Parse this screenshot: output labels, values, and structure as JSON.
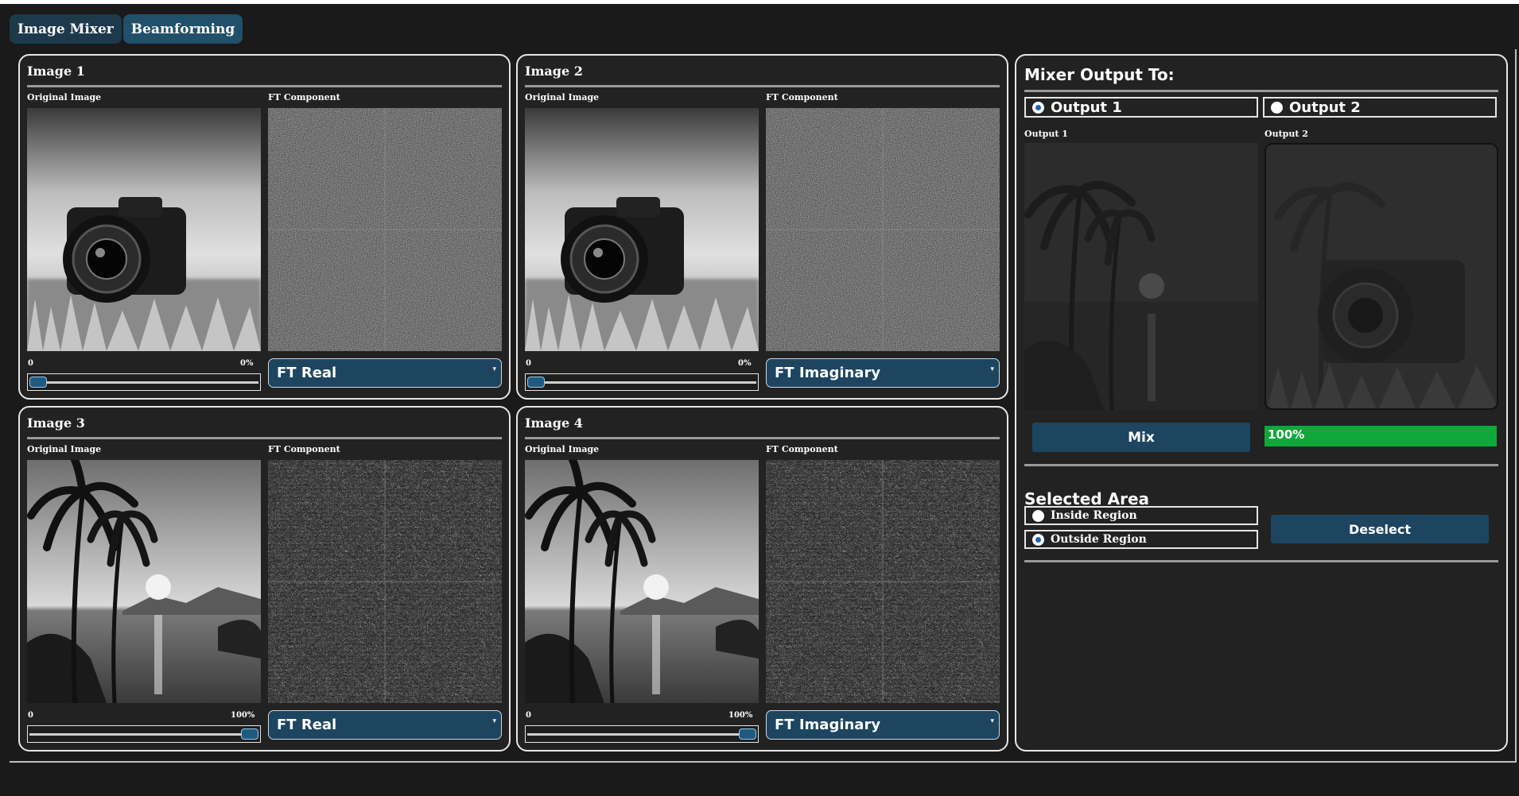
{
  "tabs": [
    {
      "label": "Image Mixer",
      "active": false
    },
    {
      "label": "Beamforming",
      "active": true
    }
  ],
  "images": [
    {
      "title": "Image 1",
      "original_label": "Original Image",
      "ft_label": "FT Component",
      "slider_min": "0",
      "slider_max": "0%",
      "weight": 0,
      "component": "FT Real",
      "picture": "camera"
    },
    {
      "title": "Image 2",
      "original_label": "Original Image",
      "ft_label": "FT Component",
      "slider_min": "0",
      "slider_max": "0%",
      "weight": 0,
      "component": "FT Imaginary",
      "picture": "camera"
    },
    {
      "title": "Image 3",
      "original_label": "Original Image",
      "ft_label": "FT Component",
      "slider_min": "0",
      "slider_max": "100%",
      "weight": 100,
      "component": "FT Real",
      "picture": "palm-sunset"
    },
    {
      "title": "Image 4",
      "original_label": "Original Image",
      "ft_label": "FT Component",
      "slider_min": "0",
      "slider_max": "100%",
      "weight": 100,
      "component": "FT Imaginary",
      "picture": "palm-sunset"
    }
  ],
  "mixer": {
    "title": "Mixer Output To:",
    "output_options": [
      {
        "label": "Output 1",
        "selected": true
      },
      {
        "label": "Output 2",
        "selected": false
      }
    ],
    "outputs": [
      {
        "label": "Output 1",
        "picture": "palm-sunset-dim"
      },
      {
        "label": "Output 2",
        "picture": "camera-palm-dim"
      }
    ],
    "mix_label": "Mix",
    "progress": {
      "value": 100,
      "text": "100%"
    }
  },
  "selected_area": {
    "title": "Selected Area",
    "options": [
      {
        "label": "Inside Region",
        "selected": false
      },
      {
        "label": "Outside Region",
        "selected": true
      }
    ],
    "deselect_label": "Deselect"
  },
  "colors": {
    "background": "#1a1a1a",
    "panel": "#222222",
    "accent": "#1d4560",
    "progress": "#10a83a",
    "radio_dot": "#1e63b0"
  }
}
